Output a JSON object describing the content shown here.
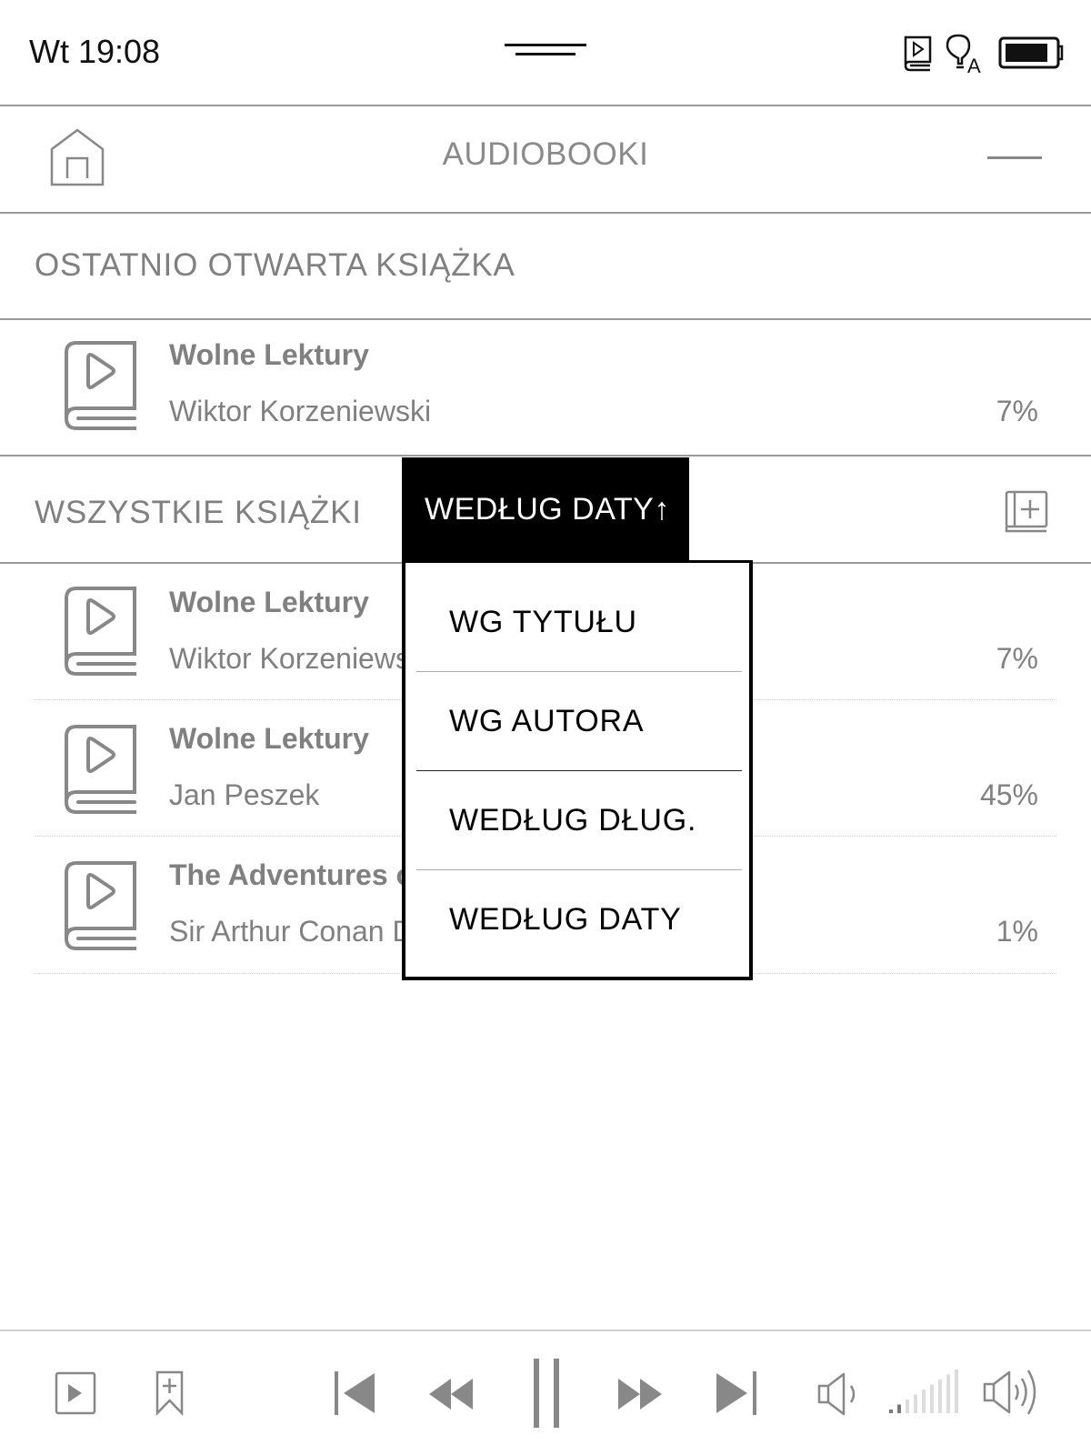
{
  "status_bar": {
    "clock": "Wt 19:08",
    "icons": [
      "audiobook-status-icon",
      "frontlight-auto-icon",
      "battery-icon"
    ]
  },
  "header": {
    "title": "AUDIOBOOKI",
    "home_icon": "home-icon",
    "menu_icon": "menu-icon"
  },
  "recent": {
    "section_title": "OSTATNIO OTWARTA KSIĄŻKA",
    "book": {
      "title": "Wolne Lektury",
      "author": "Wiktor Korzeniewski",
      "progress": "7%"
    }
  },
  "all_books": {
    "section_title": "WSZYSTKIE KSIĄŻKI",
    "sort_label": "WEDŁUG DATY↑",
    "add_icon": "add-book-icon",
    "books": [
      {
        "title": "Wolne Lektury",
        "author": "Wiktor Korzeniewski",
        "progress": "7%"
      },
      {
        "title": "Wolne Lektury",
        "author": "Jan Peszek",
        "progress": "45%"
      },
      {
        "title": "The Adventures of Sherlock Holmes",
        "author": "Sir Arthur Conan Doyle",
        "progress": "1%"
      }
    ]
  },
  "sort_menu": {
    "options": [
      "WG TYTUŁU",
      "WG AUTORA",
      "WEDŁUG DŁUG.",
      "WEDŁUG DATY"
    ]
  },
  "player": {
    "controls": [
      "now-playing",
      "add-bookmark",
      "previous-track",
      "rewind",
      "pause",
      "fast-forward",
      "next-track",
      "volume-down",
      "volume-level",
      "volume-up"
    ],
    "volume_level": {
      "filled": 2,
      "total": 9
    }
  },
  "colors": {
    "text_gray": "#808080",
    "accent_black": "#000000",
    "divider": "#9a9a9a"
  }
}
